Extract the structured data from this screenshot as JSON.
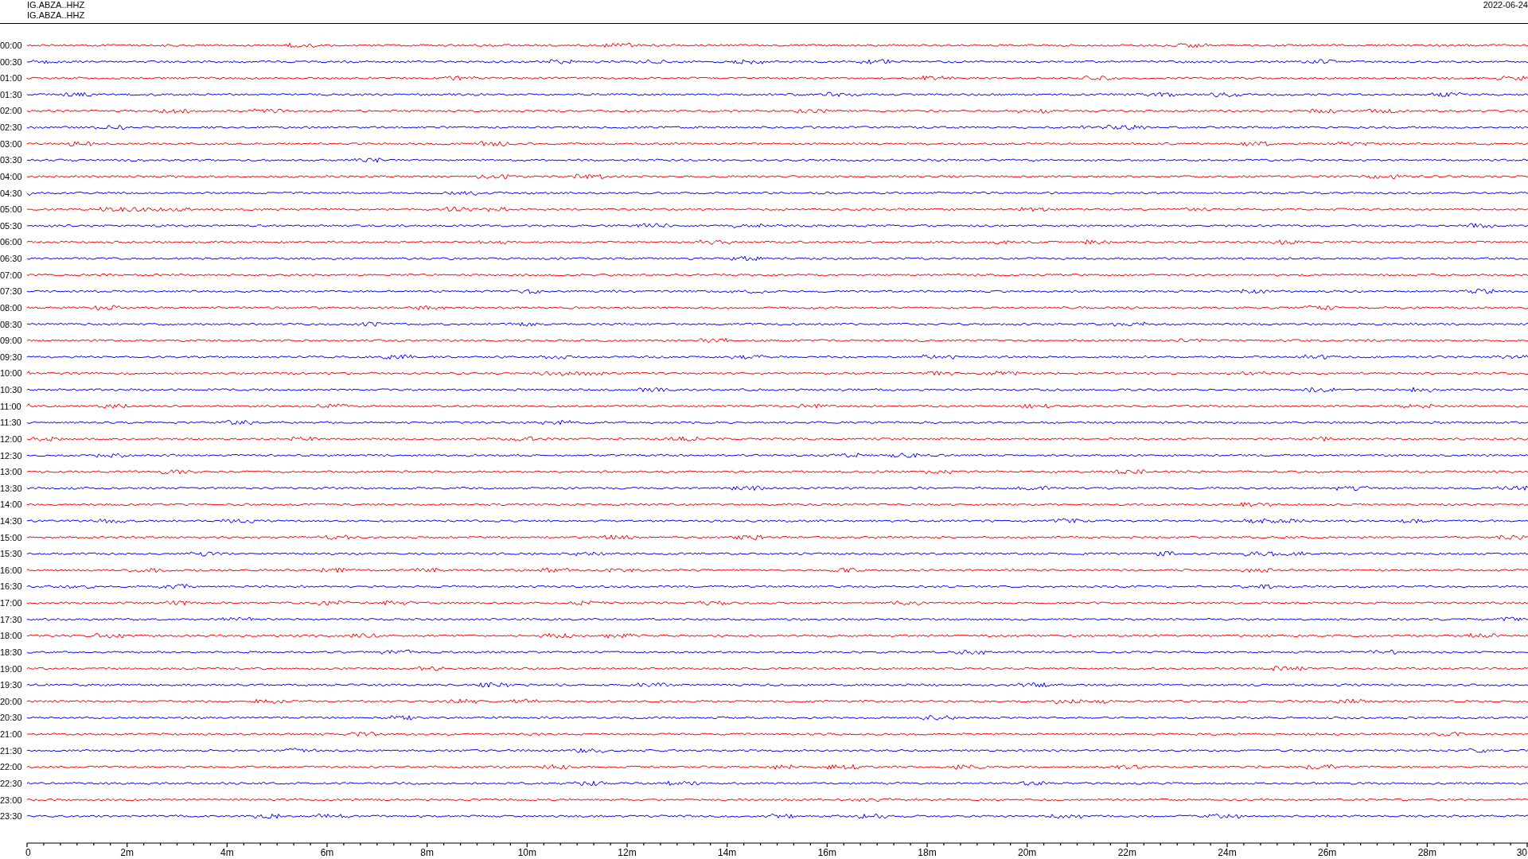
{
  "header": {
    "station_lines": [
      "IG.ABZA..HHZ",
      "IG.ABZA..HHZ"
    ],
    "date": "2022-06-24"
  },
  "traces": [
    {
      "label": "00:00",
      "color": "#ff0000"
    },
    {
      "label": "00:30",
      "color": "#0000ff"
    },
    {
      "label": "01:00",
      "color": "#ff0000"
    },
    {
      "label": "01:30",
      "color": "#0000ff"
    },
    {
      "label": "02:00",
      "color": "#ff0000"
    },
    {
      "label": "02:30",
      "color": "#0000ff"
    },
    {
      "label": "03:00",
      "color": "#ff0000"
    },
    {
      "label": "03:30",
      "color": "#0000ff"
    },
    {
      "label": "04:00",
      "color": "#ff0000"
    },
    {
      "label": "04:30",
      "color": "#0000ff"
    },
    {
      "label": "05:00",
      "color": "#ff0000"
    },
    {
      "label": "05:30",
      "color": "#0000ff"
    },
    {
      "label": "06:00",
      "color": "#ff0000"
    },
    {
      "label": "06:30",
      "color": "#0000ff"
    },
    {
      "label": "07:00",
      "color": "#ff0000"
    },
    {
      "label": "07:30",
      "color": "#0000ff"
    },
    {
      "label": "08:00",
      "color": "#ff0000"
    },
    {
      "label": "08:30",
      "color": "#0000ff"
    },
    {
      "label": "09:00",
      "color": "#ff0000"
    },
    {
      "label": "09:30",
      "color": "#0000ff"
    },
    {
      "label": "10:00",
      "color": "#ff0000"
    },
    {
      "label": "10:30",
      "color": "#0000ff"
    },
    {
      "label": "11:00",
      "color": "#ff0000"
    },
    {
      "label": "11:30",
      "color": "#0000ff"
    },
    {
      "label": "12:00",
      "color": "#ff0000"
    },
    {
      "label": "12:30",
      "color": "#0000ff"
    },
    {
      "label": "13:00",
      "color": "#ff0000"
    },
    {
      "label": "13:30",
      "color": "#0000ff"
    },
    {
      "label": "14:00",
      "color": "#ff0000"
    },
    {
      "label": "14:30",
      "color": "#0000ff"
    },
    {
      "label": "15:00",
      "color": "#ff0000"
    },
    {
      "label": "15:30",
      "color": "#0000ff"
    },
    {
      "label": "16:00",
      "color": "#ff0000"
    },
    {
      "label": "16:30",
      "color": "#0000ff"
    },
    {
      "label": "17:00",
      "color": "#ff0000"
    },
    {
      "label": "17:30",
      "color": "#0000ff"
    },
    {
      "label": "18:00",
      "color": "#ff0000"
    },
    {
      "label": "18:30",
      "color": "#0000ff"
    },
    {
      "label": "19:00",
      "color": "#ff0000"
    },
    {
      "label": "19:30",
      "color": "#0000ff"
    },
    {
      "label": "20:00",
      "color": "#ff0000"
    },
    {
      "label": "20:30",
      "color": "#0000ff"
    },
    {
      "label": "21:00",
      "color": "#ff0000"
    },
    {
      "label": "21:30",
      "color": "#0000ff"
    },
    {
      "label": "22:00",
      "color": "#ff0000"
    },
    {
      "label": "22:30",
      "color": "#0000ff"
    },
    {
      "label": "23:00",
      "color": "#ff0000"
    },
    {
      "label": "23:30",
      "color": "#0000ff"
    }
  ],
  "x_axis": {
    "tick_labels": [
      "0",
      "2m",
      "4m",
      "6m",
      "8m",
      "10m",
      "12m",
      "14m",
      "16m",
      "18m",
      "20m",
      "22m",
      "24m",
      "26m",
      "28m",
      "30"
    ]
  }
}
